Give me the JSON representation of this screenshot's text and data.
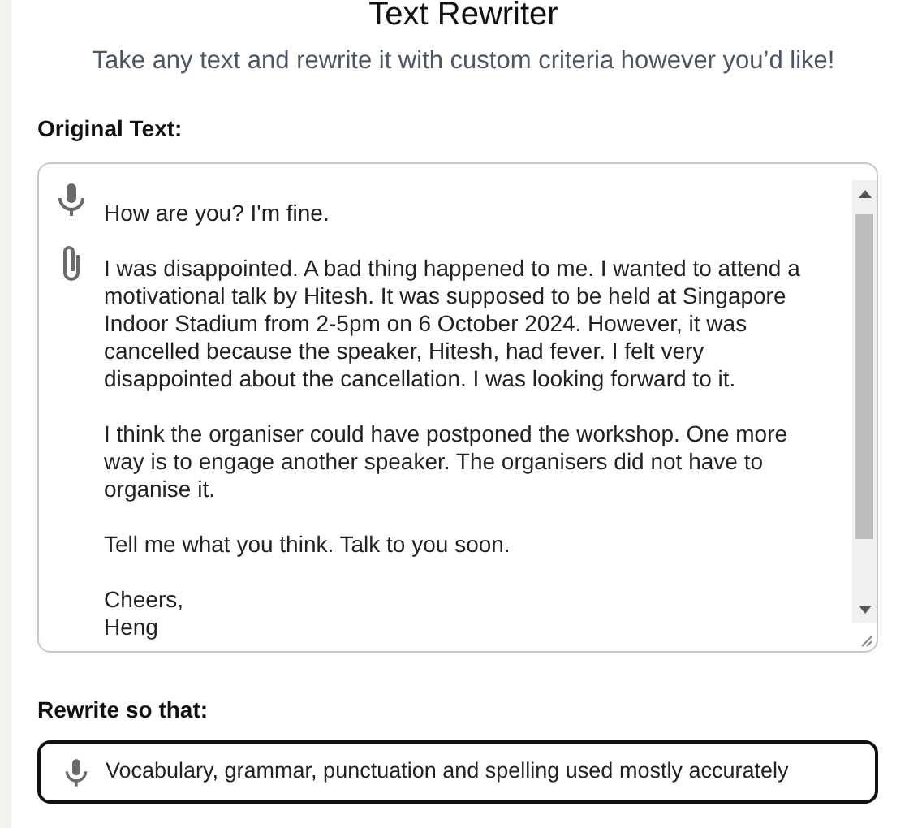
{
  "header": {
    "title": "Text Rewriter",
    "subtitle": "Take any text and rewrite it with custom criteria however you’d like!"
  },
  "original_text": {
    "label": "Original Text:",
    "paragraphs": [
      "How are you? I'm fine.",
      "I was disappointed. A bad thing happened to me. I wanted to attend a motivational talk by Hitesh. It was supposed to be held at Singapore Indoor Stadium from 2-5pm on 6 October 2024. However, it was cancelled because the speaker, Hitesh, had fever. I felt very disappointed about the cancellation. I was looking forward to it.",
      "I think the organiser could have postponed the workshop. One more way is to engage another speaker. The organisers did not have to organise it.",
      "Tell me what you think. Talk to you soon.",
      "Cheers,\nHeng"
    ]
  },
  "rewrite": {
    "label": "Rewrite so that:",
    "value": "Vocabulary, grammar, punctuation and spelling used mostly accurately",
    "focused": true
  }
}
